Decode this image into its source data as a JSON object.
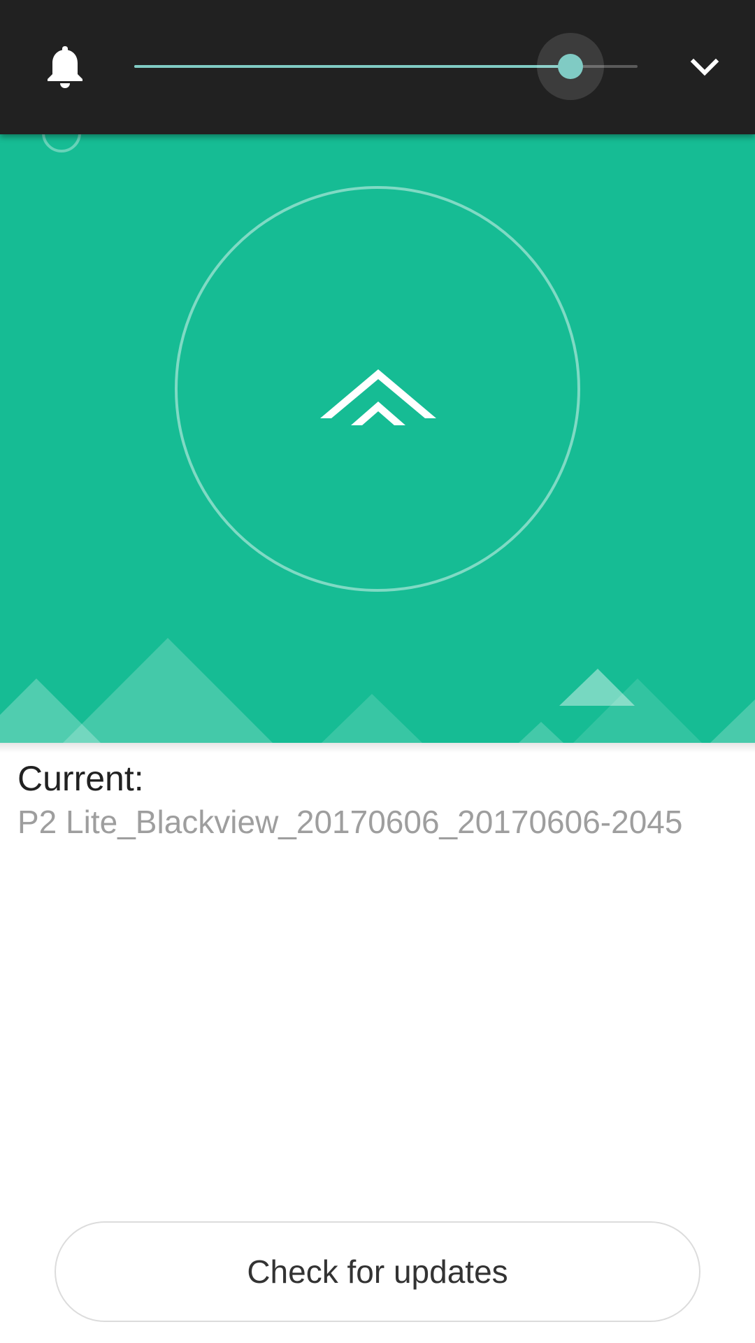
{
  "volume_panel": {
    "icon": "bell-icon",
    "level": 0.866,
    "expand_icon": "chevron-down-icon",
    "accent_color": "#80cbc4",
    "background_color": "#212121"
  },
  "hero": {
    "background_color": "#16bc94",
    "icon": "double-chevron-up-icon"
  },
  "current": {
    "label": "Current:",
    "version": "P2 Lite_Blackview_20170606_20170606-2045"
  },
  "actions": {
    "check_label": "Check for updates"
  }
}
